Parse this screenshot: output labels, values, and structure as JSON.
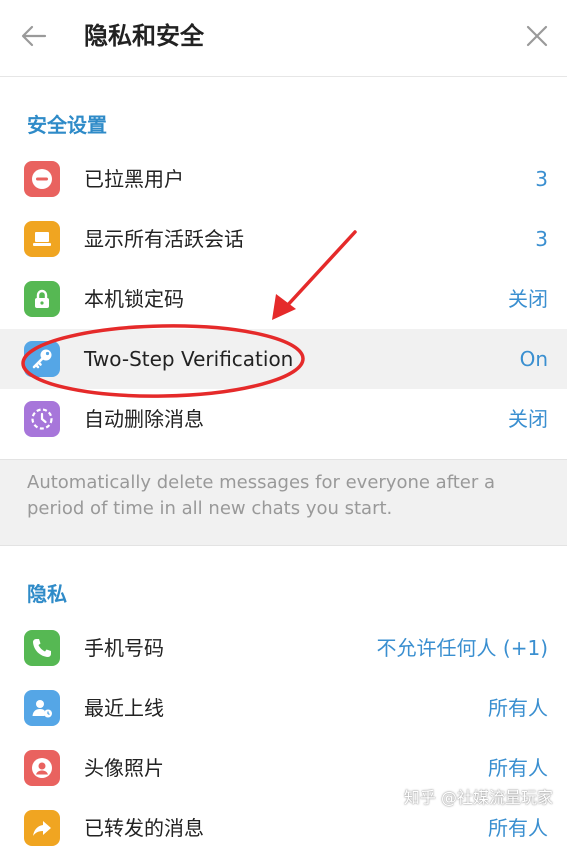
{
  "header": {
    "title": "隐私和安全"
  },
  "security": {
    "title": "安全设置",
    "items": [
      {
        "label": "已拉黑用户",
        "value": "3",
        "icon": "block-icon",
        "color": "#e9625f"
      },
      {
        "label": "显示所有活跃会话",
        "value": "3",
        "icon": "laptop-icon",
        "color": "#f0a521"
      },
      {
        "label": "本机锁定码",
        "value": "关闭",
        "icon": "lock-icon",
        "color": "#56b853"
      },
      {
        "label": "Two-Step Verification",
        "value": "On",
        "icon": "key-icon",
        "color": "#55a6e6"
      },
      {
        "label": "自动删除消息",
        "value": "关闭",
        "icon": "timer-icon",
        "color": "#a776da"
      }
    ],
    "info": "Automatically delete messages for everyone after a period of time in all new chats you start."
  },
  "privacy": {
    "title": "隐私",
    "items": [
      {
        "label": "手机号码",
        "value": "不允许任何人 (+1)",
        "icon": "phone-icon",
        "color": "#56b853"
      },
      {
        "label": "最近上线",
        "value": "所有人",
        "icon": "user-clock-icon",
        "color": "#55a6e6"
      },
      {
        "label": "头像照片",
        "value": "所有人",
        "icon": "avatar-icon",
        "color": "#e9625f"
      },
      {
        "label": "已转发的消息",
        "value": "所有人",
        "icon": "forward-icon",
        "color": "#f0a521"
      }
    ]
  },
  "watermark": "知乎 @社媒流量玩家"
}
